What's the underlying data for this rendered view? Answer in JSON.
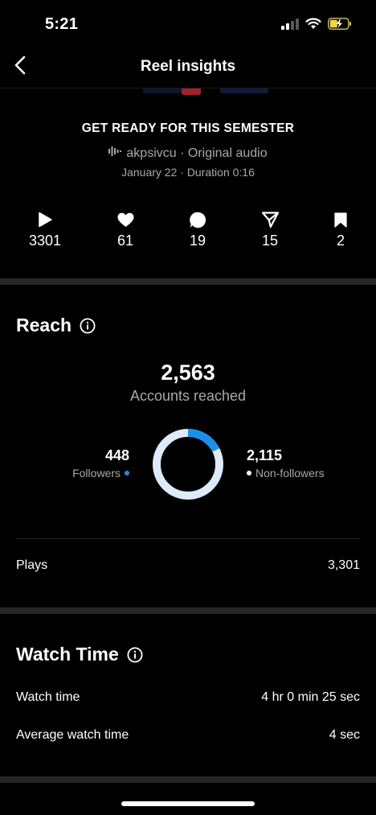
{
  "status": {
    "time": "5:21",
    "icons": [
      "signal-icon",
      "wifi-icon",
      "battery-charging-icon"
    ]
  },
  "nav": {
    "title": "Reel insights",
    "back_icon": "chevron-left-icon"
  },
  "reel": {
    "title": "GET READY FOR THIS SEMESTER",
    "audio_icon": "audio-wave-icon",
    "audio": "akpsivcu · Original audio",
    "meta": "January 22 · Duration 0:16"
  },
  "stats": [
    {
      "icon": "play-icon",
      "value": "3301"
    },
    {
      "icon": "heart-icon",
      "value": "61"
    },
    {
      "icon": "comment-icon",
      "value": "19"
    },
    {
      "icon": "share-icon",
      "value": "15"
    },
    {
      "icon": "bookmark-icon",
      "value": "2"
    }
  ],
  "reach": {
    "title": "Reach",
    "accounts_reached": "2,563",
    "accounts_reached_label": "Accounts reached",
    "followers_value": "448",
    "followers_label": "Followers",
    "nonfollowers_value": "2,115",
    "nonfollowers_label": "Non-followers",
    "followers_fraction": 0.175,
    "followers_color": "#1b8fea",
    "nonfollowers_color": "#dceafa",
    "plays_label": "Plays",
    "plays_value": "3,301"
  },
  "watch_time": {
    "title": "Watch Time",
    "watch_time_label": "Watch time",
    "watch_time_value": "4 hr 0 min 25 sec",
    "avg_label": "Average watch time",
    "avg_value": "4 sec"
  }
}
